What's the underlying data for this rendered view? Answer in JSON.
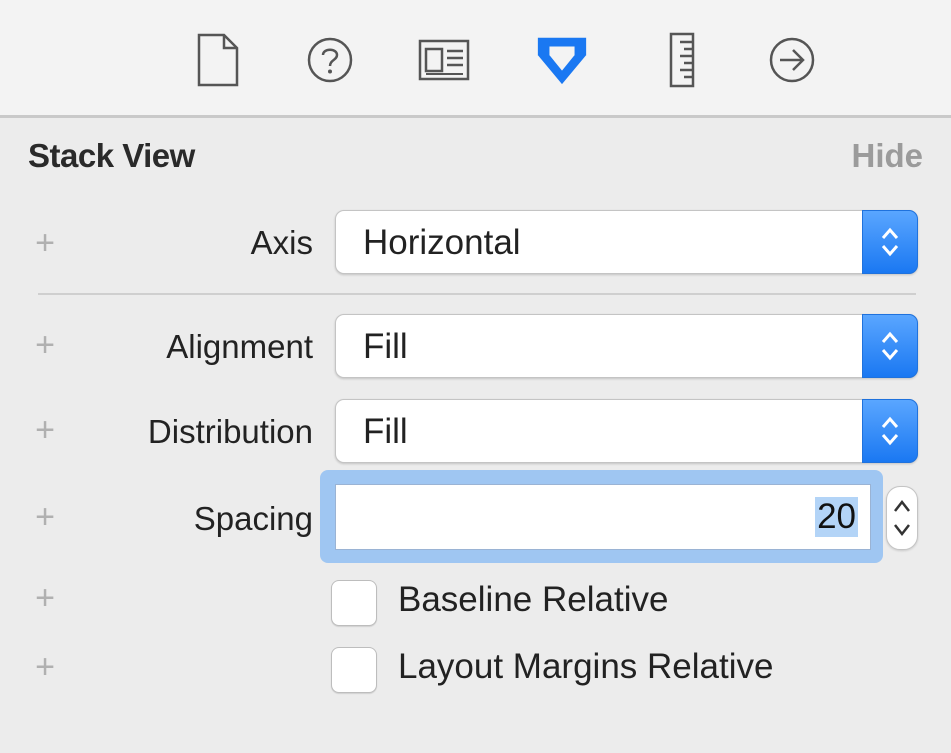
{
  "tabs": [
    {
      "icon": "file-icon",
      "active": false
    },
    {
      "icon": "help-icon",
      "active": false
    },
    {
      "icon": "identity-icon",
      "active": false
    },
    {
      "icon": "attributes-icon",
      "active": true
    },
    {
      "icon": "size-ruler-icon",
      "active": false
    },
    {
      "icon": "connections-arrow-icon",
      "active": false
    }
  ],
  "colors": {
    "accent": "#1a78f2",
    "panel": "#ececec",
    "focus_ring": "#9fc6f2"
  },
  "section": {
    "title": "Stack View",
    "hide_label": "Hide"
  },
  "fields": {
    "axis": {
      "label": "Axis",
      "value": "Horizontal"
    },
    "alignment": {
      "label": "Alignment",
      "value": "Fill"
    },
    "distribution": {
      "label": "Distribution",
      "value": "Fill"
    },
    "spacing": {
      "label": "Spacing",
      "value": "20"
    }
  },
  "checkboxes": {
    "baseline": {
      "label": "Baseline Relative",
      "checked": false
    },
    "layout_margins": {
      "label": "Layout Margins Relative",
      "checked": false
    }
  },
  "plus_symbol": "+"
}
